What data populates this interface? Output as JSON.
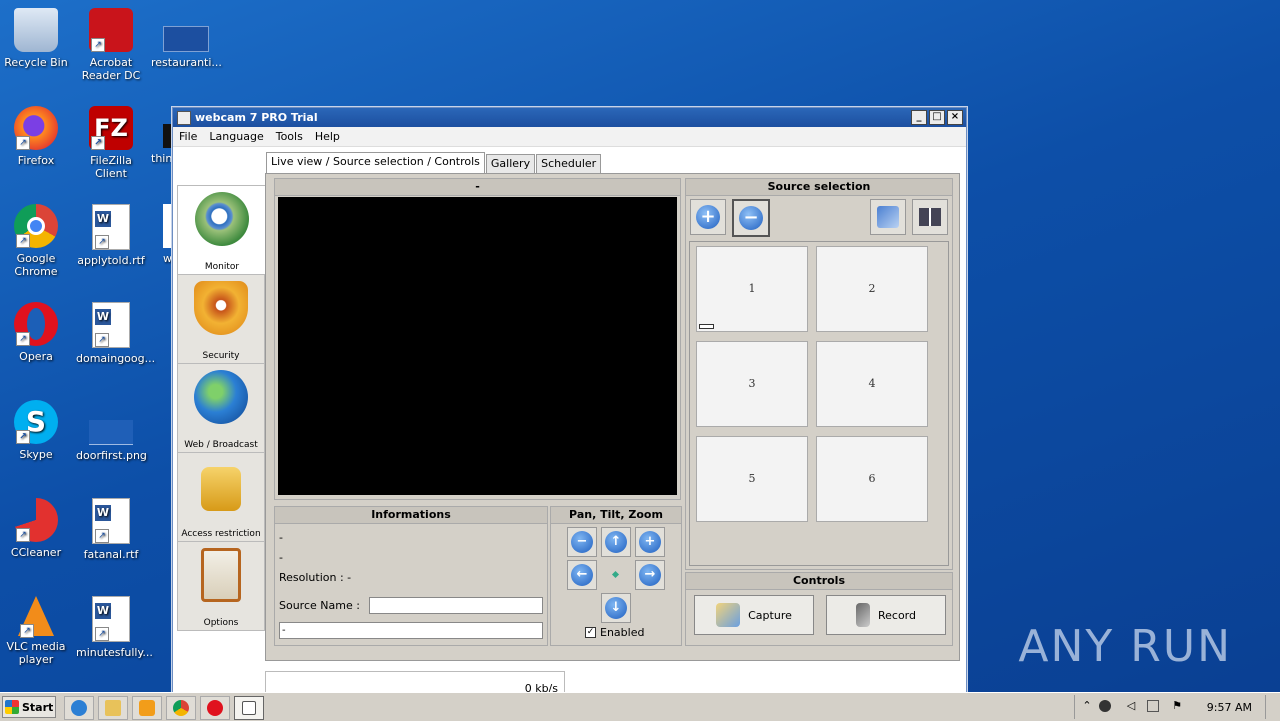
{
  "desktop": {
    "icons": [
      {
        "label": "Recycle Bin"
      },
      {
        "label": "Acrobat Reader DC"
      },
      {
        "label": "restauranti..."
      },
      {
        "label": "Firefox"
      },
      {
        "label": "FileZilla Client"
      },
      {
        "label": "thin"
      },
      {
        "label": "Google Chrome"
      },
      {
        "label": "applytold.rtf"
      },
      {
        "label": "w"
      },
      {
        "label": "Opera"
      },
      {
        "label": "domaingoog..."
      },
      {
        "label": "Skype"
      },
      {
        "label": "doorfirst.png"
      },
      {
        "label": "CCleaner"
      },
      {
        "label": "fatanal.rtf"
      },
      {
        "label": "VLC media player"
      },
      {
        "label": "minutesfully..."
      }
    ],
    "watermark": "ANY RUN"
  },
  "window": {
    "title": "webcam 7 PRO Trial",
    "menu": [
      "File",
      "Language",
      "Tools",
      "Help"
    ],
    "tabs": [
      "Live view / Source selection / Controls",
      "Gallery",
      "Scheduler"
    ],
    "sidebar": [
      {
        "label": "Monitor"
      },
      {
        "label": "Security"
      },
      {
        "label": "Web / Broadcast"
      },
      {
        "label": "Access restriction"
      },
      {
        "label": "Options"
      }
    ],
    "video": {
      "title": "-"
    },
    "info": {
      "title": "Informations",
      "line1": "-",
      "line2": "-",
      "resolution": "Resolution : -",
      "source_name_label": "Source Name :",
      "source_name_value": "",
      "bottom_field": "-"
    },
    "ptz": {
      "title": "Pan, Tilt, Zoom",
      "enabled_label": "Enabled",
      "enabled": true
    },
    "source": {
      "title": "Source selection",
      "slots": [
        "1",
        "2",
        "3",
        "4",
        "5",
        "6"
      ]
    },
    "controls": {
      "title": "Controls",
      "capture": "Capture",
      "record": "Record"
    },
    "status": {
      "rate": "0 kb/s"
    }
  },
  "taskbar": {
    "start_label": "Start",
    "clock": "9:57 AM"
  }
}
